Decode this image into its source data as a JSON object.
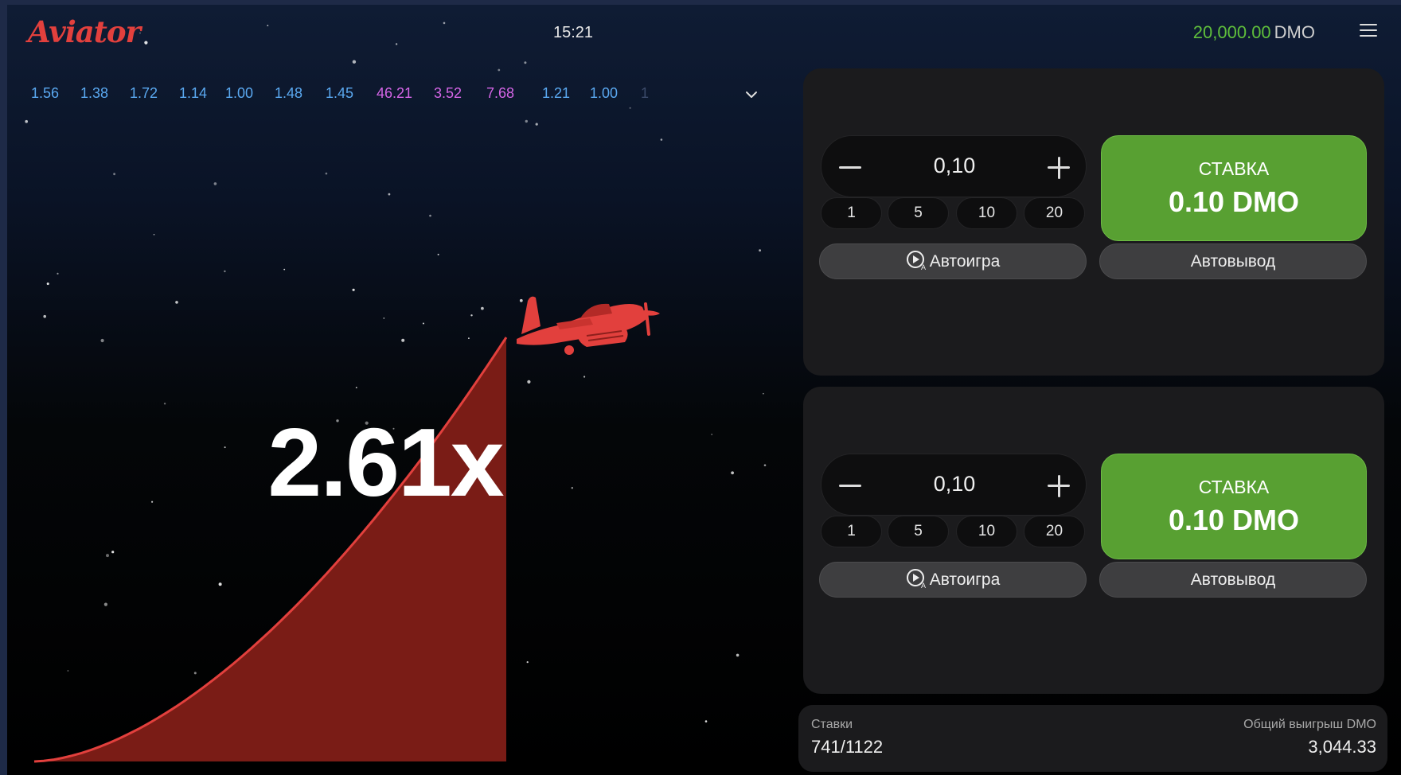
{
  "header": {
    "logo": "Aviator",
    "clock": "15:21",
    "balance_amount": "20,000.00",
    "balance_currency": "DMO"
  },
  "history": [
    {
      "value": "1.56",
      "tier": "low"
    },
    {
      "value": "1.38",
      "tier": "low"
    },
    {
      "value": "1.72",
      "tier": "low"
    },
    {
      "value": "1.14",
      "tier": "low"
    },
    {
      "value": "1.00",
      "tier": "low"
    },
    {
      "value": "1.48",
      "tier": "low"
    },
    {
      "value": "1.45",
      "tier": "low"
    },
    {
      "value": "46.21",
      "tier": "high"
    },
    {
      "value": "3.52",
      "tier": "high"
    },
    {
      "value": "7.68",
      "tier": "high"
    },
    {
      "value": "1.21",
      "tier": "low"
    },
    {
      "value": "1.00",
      "tier": "low"
    },
    {
      "value": "1",
      "tier": "fade"
    }
  ],
  "game": {
    "multiplier": "2.61x",
    "plane_color": "#e2403d",
    "trail_color": "#7a1c16"
  },
  "bets": [
    {
      "amount": "0,10",
      "chips": [
        "1",
        "5",
        "10",
        "20"
      ],
      "bet_label": "СТАВКА",
      "bet_amount": "0.10 DMO",
      "autoplay_label": "Автоигра",
      "autocashout_label": "Автовывод"
    },
    {
      "amount": "0,10",
      "chips": [
        "1",
        "5",
        "10",
        "20"
      ],
      "bet_label": "СТАВКА",
      "bet_amount": "0.10 DMO",
      "autoplay_label": "Автоигра",
      "autocashout_label": "Автовывод"
    }
  ],
  "stats": {
    "bets_label": "Ставки",
    "bets_value": "741/1122",
    "total_win_label": "Общий выигрыш DMO",
    "total_win_value": "3,044.33"
  },
  "colors": {
    "accent_green": "#58a032",
    "balance_green": "#5fbf3b",
    "history_low": "#5aa8f0",
    "history_high": "#d465e6"
  }
}
